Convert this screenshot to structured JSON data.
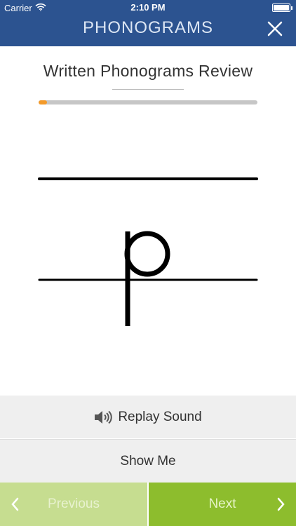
{
  "status_bar": {
    "carrier": "Carrier",
    "time": "2:10 PM"
  },
  "header": {
    "title": "PHONOGRAMS"
  },
  "review": {
    "title": "Written Phonograms Review",
    "progress": 0.04
  },
  "phonogram": {
    "letter": "p"
  },
  "actions": {
    "replay_label": "Replay Sound",
    "show_me_label": "Show Me"
  },
  "nav": {
    "previous_label": "Previous",
    "next_label": "Next"
  },
  "colors": {
    "header_bg": "#2c5390",
    "progress_accent": "#f39a2a",
    "previous_bg": "#c6dd90",
    "next_bg": "#8dbd2d"
  },
  "icons": [
    "wifi-icon",
    "battery-icon",
    "close-icon",
    "speaker-icon",
    "chevron-left-icon",
    "chevron-right-icon"
  ]
}
